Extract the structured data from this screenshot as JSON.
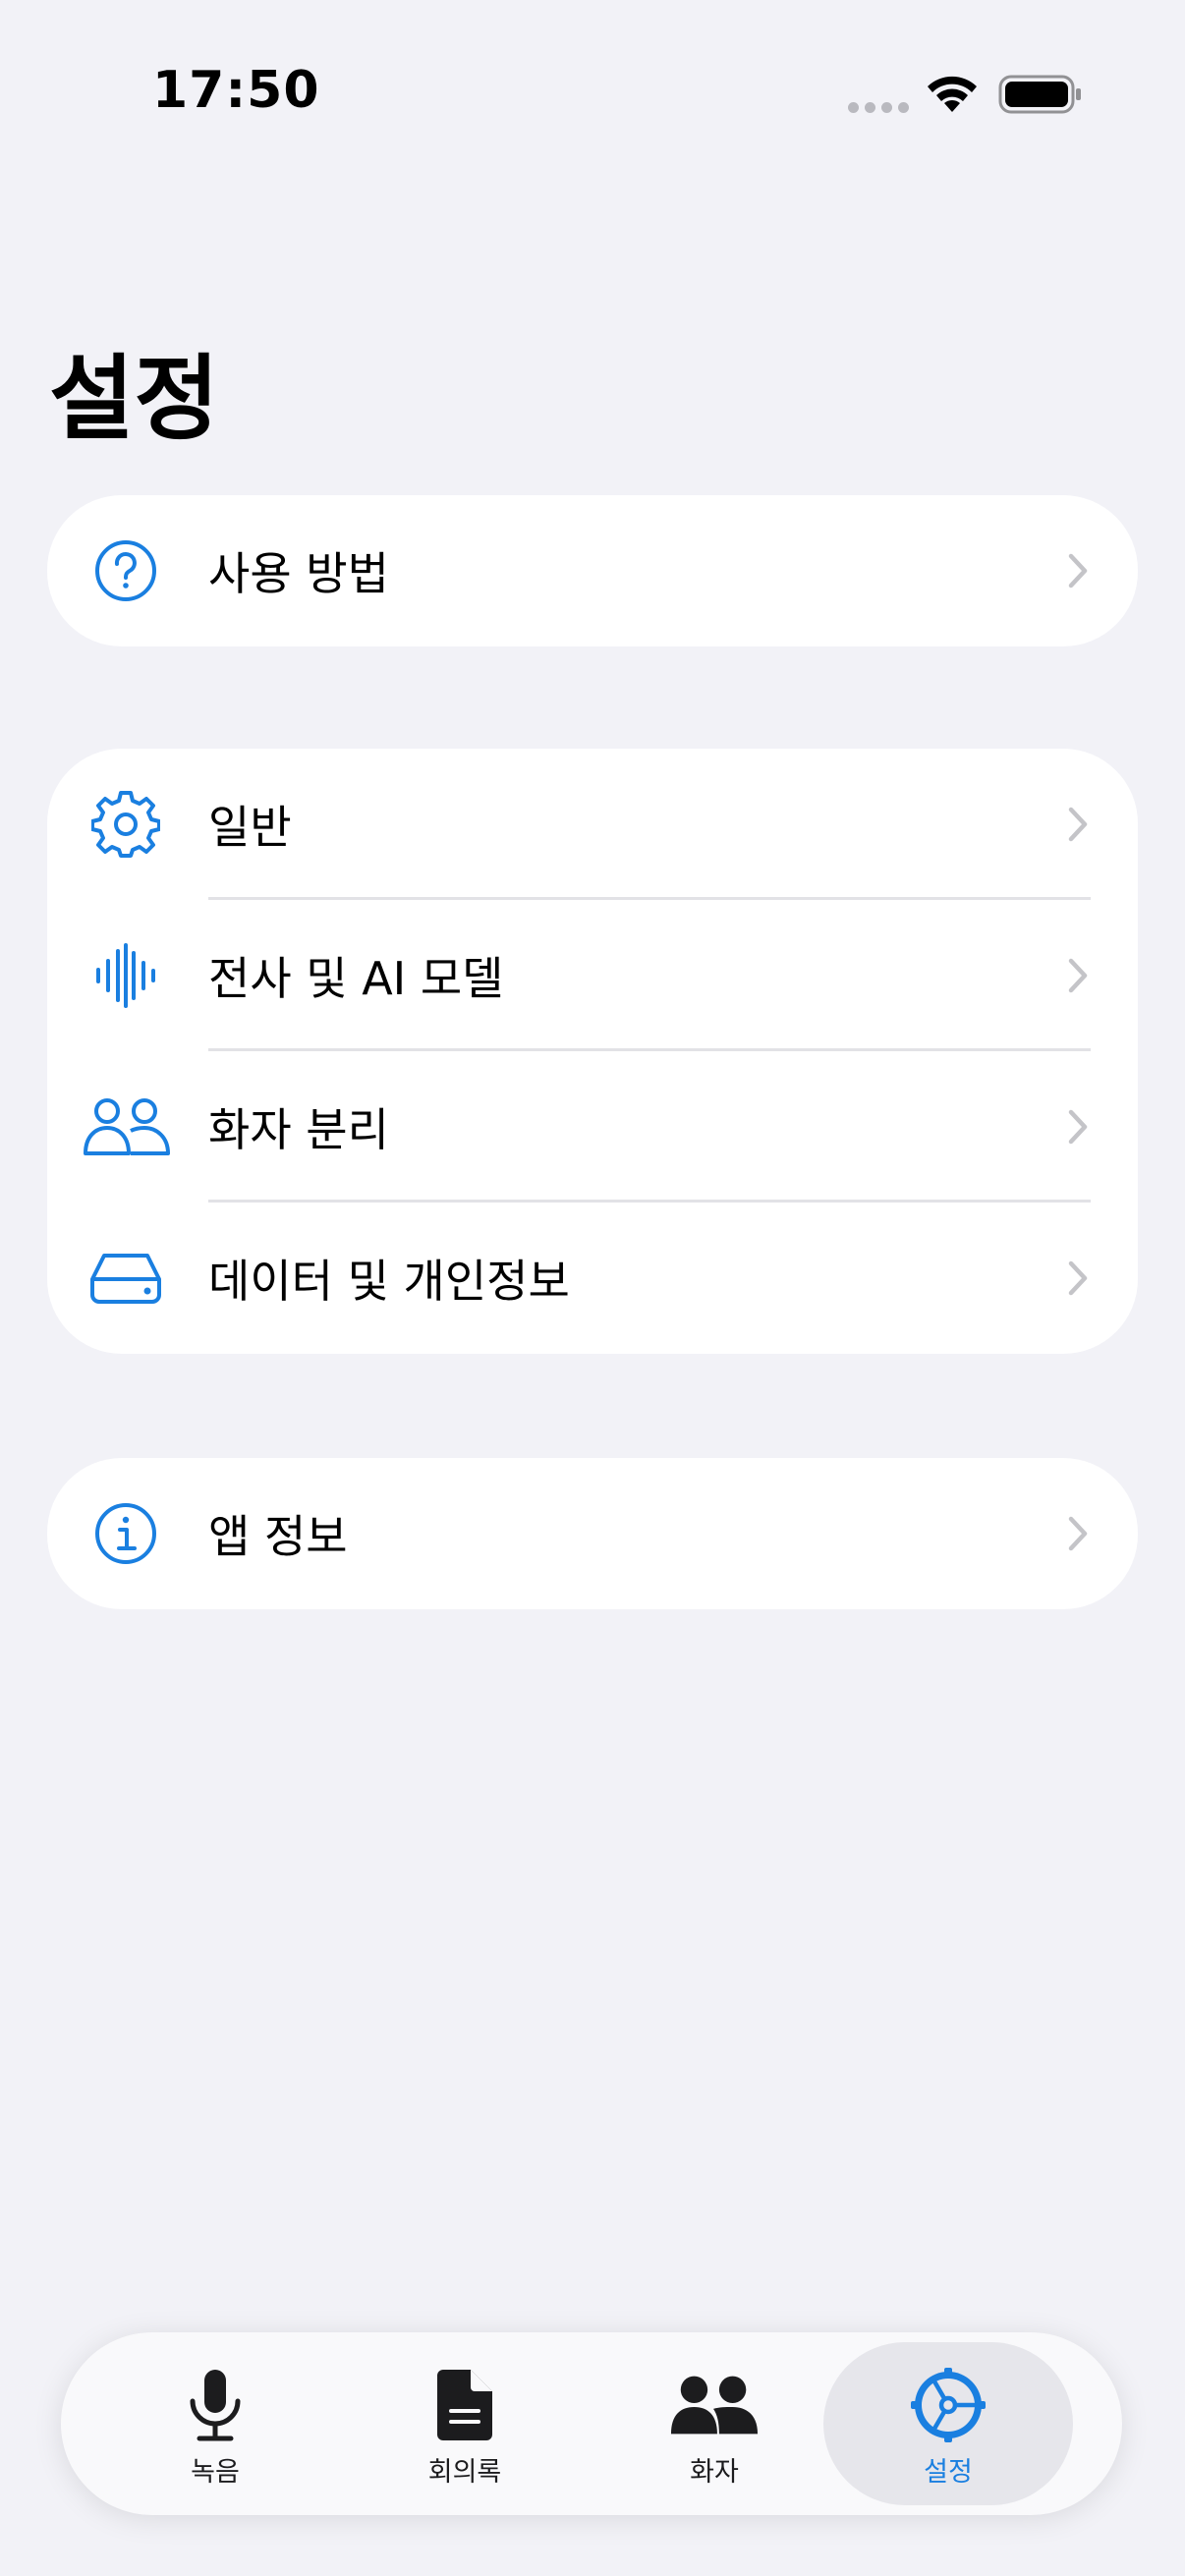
{
  "status_bar": {
    "time": "17:50"
  },
  "page": {
    "title": "설정"
  },
  "colors": {
    "accent": "#1A7FE0",
    "background": "#F2F2F7",
    "chevron": "#C4C4C8"
  },
  "groups": [
    {
      "rows": [
        {
          "label": "사용 방법",
          "icon": "question-circle-icon"
        }
      ]
    },
    {
      "rows": [
        {
          "label": "일반",
          "icon": "gear-icon"
        },
        {
          "label": "전사 및 AI 모델",
          "icon": "waveform-icon"
        },
        {
          "label": "화자 분리",
          "icon": "people-icon"
        },
        {
          "label": "데이터 및 개인정보",
          "icon": "drive-icon"
        }
      ]
    },
    {
      "rows": [
        {
          "label": "앱 정보",
          "icon": "info-circle-icon"
        }
      ]
    }
  ],
  "tab_bar": {
    "tabs": [
      {
        "label": "녹음",
        "icon": "microphone-icon",
        "active": false
      },
      {
        "label": "회의록",
        "icon": "document-icon",
        "active": false
      },
      {
        "label": "화자",
        "icon": "people-fill-icon",
        "active": false
      },
      {
        "label": "설정",
        "icon": "settings-gear-icon",
        "active": true
      }
    ]
  }
}
